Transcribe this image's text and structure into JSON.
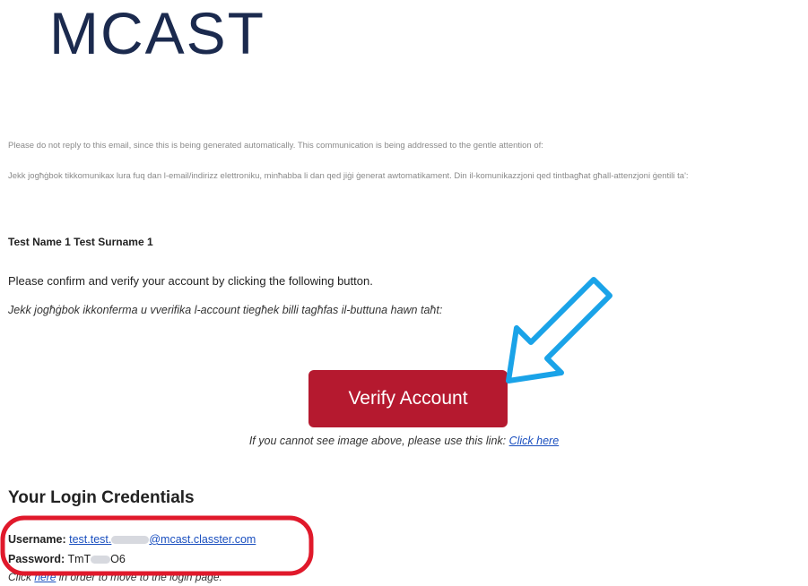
{
  "brand": {
    "logo_text": "MCAST"
  },
  "notice": {
    "english": "Please do not reply to this email, since this is being generated automatically.  This communication is being addressed to the gentle attention of:",
    "maltese": "Jekk jogħġbok tikkomunikax lura fuq dan l-email/indirizz elettroniku, minħabba li dan qed jiġi ġenerat awtomatikament. Din il-komunikazzjoni qed tintbagħat għall-attenzjoni ġentili ta':"
  },
  "recipient": "Test Name 1 Test Surname 1",
  "confirm": {
    "english": "Please confirm and verify your account by clicking the following button.",
    "maltese": "Jekk jogħġbok ikkonferma u vverifika l-account tiegħek billi tagħfas il-buttuna hawn taħt:"
  },
  "verify_button": "Verify Account",
  "fallback": {
    "text": "If you cannot see image above, please use this link: ",
    "link": "Click here"
  },
  "credentials": {
    "title": "Your Login Credentials",
    "username_label": "Username:",
    "username_prefix": "test.test.",
    "username_suffix": "@mcast.classter.com",
    "password_label": "Password:",
    "password_prefix": "TmT",
    "password_suffix": "O6"
  },
  "login_line": {
    "pre": "Click ",
    "link": "here",
    "post": " in order to  move to the login page."
  },
  "colors": {
    "brand_navy": "#1b2a4e",
    "button_red": "#b5192f",
    "arrow_blue": "#1aa3e8",
    "highlight_red": "#e0192b",
    "link_blue": "#1a4fbf"
  }
}
